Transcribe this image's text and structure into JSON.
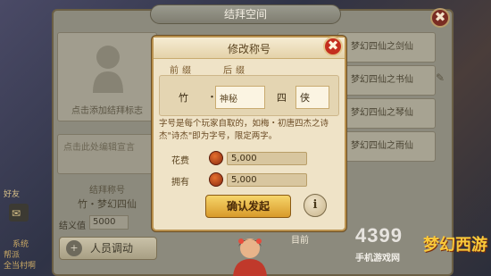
{
  "background_panel": {
    "title": "结拜空间",
    "close_label": "✖"
  },
  "left_column": {
    "avatar_caption": "点击添加结拜标志",
    "motto_placeholder": "点击此处编辑宣言",
    "sworn_label": "结拜称号",
    "sworn_name": "竹・梦幻四仙",
    "bond_label": "结义值",
    "bond_value": "5000",
    "member_button": "人员调动"
  },
  "hud": {
    "friend": "好友",
    "system": "系统",
    "guild1": "帮派",
    "guild2": "全当村啊"
  },
  "right_list": {
    "items": [
      "梦幻四仙之剑仙",
      "梦幻四仙之书仙",
      "梦幻四仙之琴仙",
      "梦幻四仙之雨仙"
    ],
    "current_label": "目前"
  },
  "modal": {
    "title": "修改称号",
    "close_label": "✖",
    "prefix_label": "前缀",
    "suffix_label": "后缀",
    "fixed_prefix": "竹",
    "separator": "・",
    "suffix_value": "神秘",
    "fixed_number": "四",
    "last_char": "侠",
    "description": "字号是每个玩家自取的，如梅・初唐四杰之诗杰\"诗杰\"即为字号，限定两字。",
    "cost_label": "花费",
    "cost_value": "5,000",
    "own_label": "拥有",
    "own_value": "5,000",
    "confirm_label": "确认发起",
    "info_label": "i"
  },
  "watermark": {
    "number": "4399",
    "subtitle": "手机游戏网",
    "logo": "梦幻西游"
  }
}
